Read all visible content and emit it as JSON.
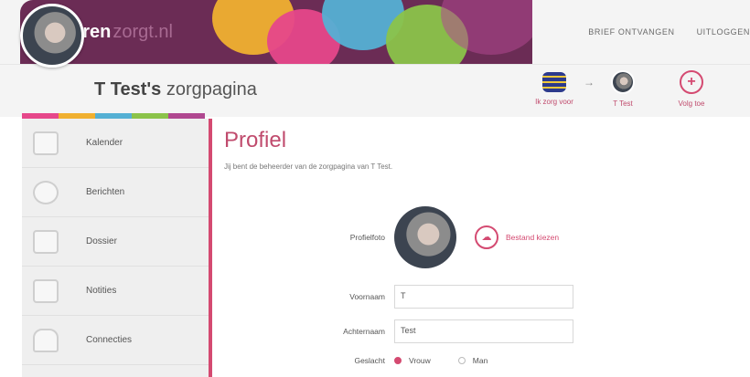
{
  "brand": {
    "name": "caren",
    "suffix": "zorgt.nl"
  },
  "top_links": [
    "BRIEF ONTVANGEN",
    "UITLOGGEN"
  ],
  "page_header": {
    "owner": "T Test's",
    "title": "zorgpagina",
    "flow": [
      {
        "label": "Ik zorg voor",
        "icon": "care-stack-icon"
      },
      {
        "label": "T Test",
        "icon": "person-avatar-icon"
      },
      {
        "label": "Volg toe",
        "icon": "plus-circle-icon"
      }
    ]
  },
  "sidebar": {
    "items": [
      {
        "label": "Kalender",
        "icon": "calendar-icon"
      },
      {
        "label": "Berichten",
        "icon": "chat-icon"
      },
      {
        "label": "Dossier",
        "icon": "clipboard-icon"
      },
      {
        "label": "Notities",
        "icon": "notes-icon"
      },
      {
        "label": "Connecties",
        "icon": "people-icon"
      }
    ]
  },
  "main": {
    "heading": "Profiel",
    "subtitle": "Jij bent de beheerder van de zorgpagina van T Test.",
    "form": {
      "photo_label": "Profielfoto",
      "upload_label": "Bestand kiezen",
      "first_name_label": "Voornaam",
      "first_name_value": "T",
      "last_name_label": "Achternaam",
      "last_name_value": "Test",
      "gender_label": "Geslacht",
      "gender_options": [
        "Vrouw",
        "Man"
      ],
      "gender_selected": "Vrouw"
    }
  },
  "colors": {
    "brand": "#6b2c55",
    "accent": "#d44a71"
  }
}
